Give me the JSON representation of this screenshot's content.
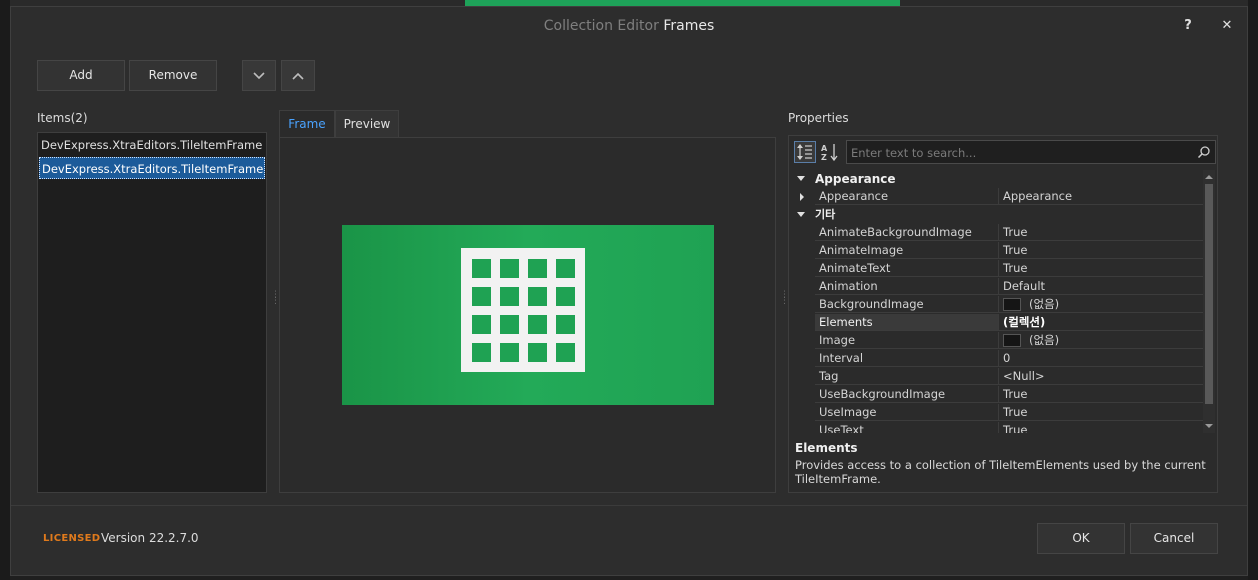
{
  "title": {
    "prefix": "Collection Editor",
    "main": "Frames"
  },
  "window_controls": {
    "help_label": "?",
    "close_label": "✕"
  },
  "toolbar": {
    "add_label": "Add",
    "remove_label": "Remove",
    "down_label": "⌄",
    "up_label": "⌃"
  },
  "items": {
    "header": "Items(2)",
    "list": [
      "DevExpress.XtraEditors.TileItemFrame",
      "DevExpress.XtraEditors.TileItemFrame"
    ],
    "selected_index": 1
  },
  "tabs": [
    {
      "label": "Frame",
      "active": true
    },
    {
      "label": "Preview",
      "active": false
    }
  ],
  "preview": {
    "tile_color": "#1fa253",
    "icon": "grid-icon"
  },
  "properties": {
    "header": "Properties",
    "search_placeholder": "Enter text to search...",
    "rows": [
      {
        "kind": "category",
        "name": "Appearance",
        "expanded": true
      },
      {
        "kind": "prop",
        "name": "Appearance",
        "value": "Appearance",
        "expandable": true
      },
      {
        "kind": "category",
        "name": "기타",
        "expanded": true
      },
      {
        "kind": "prop",
        "name": "AnimateBackgroundImage",
        "value": "True"
      },
      {
        "kind": "prop",
        "name": "AnimateImage",
        "value": "True"
      },
      {
        "kind": "prop",
        "name": "AnimateText",
        "value": "True"
      },
      {
        "kind": "prop",
        "name": "Animation",
        "value": "Default"
      },
      {
        "kind": "prop",
        "name": "BackgroundImage",
        "value": "(없음)",
        "swatch": true
      },
      {
        "kind": "prop",
        "name": "Elements",
        "value": "(컬렉션)",
        "selected": true
      },
      {
        "kind": "prop",
        "name": "Image",
        "value": "(없음)",
        "swatch": true
      },
      {
        "kind": "prop",
        "name": "Interval",
        "value": "0"
      },
      {
        "kind": "prop",
        "name": "Tag",
        "value": "<Null>"
      },
      {
        "kind": "prop",
        "name": "UseBackgroundImage",
        "value": "True"
      },
      {
        "kind": "prop",
        "name": "UseImage",
        "value": "True"
      },
      {
        "kind": "prop",
        "name": "UseText",
        "value": "True"
      }
    ],
    "description_title": "Elements",
    "description_text": "Provides access to a collection of TileItemElements used by the current TileItemFrame."
  },
  "footer": {
    "licensed": "LICENSED",
    "version": "Version 22.2.7.0",
    "ok_label": "OK",
    "cancel_label": "Cancel"
  },
  "background": {
    "right_text": "Elements"
  },
  "colors": {
    "accent": "#4aa3ff",
    "selection": "#1c5b9a",
    "licensed": "#e07a1c",
    "tile": "#1fa253"
  }
}
